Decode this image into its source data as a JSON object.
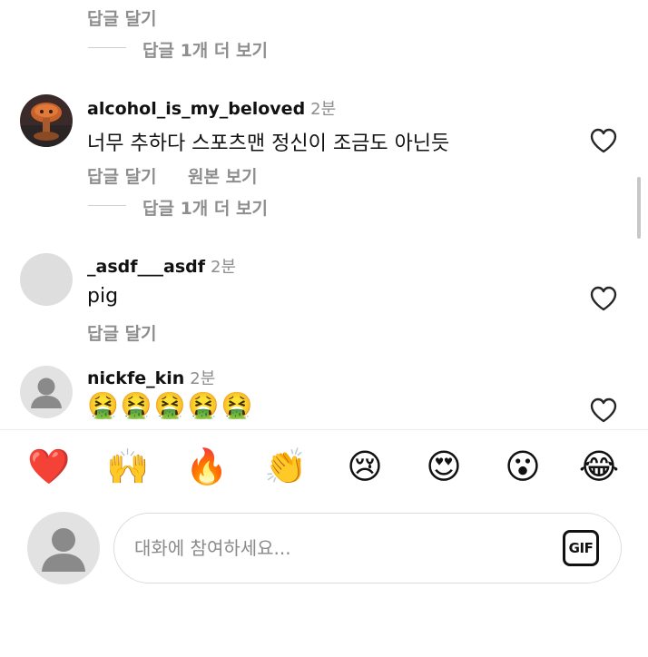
{
  "top_thread": {
    "reply_label": "답글 달기",
    "more_replies": "답글 1개 더 보기"
  },
  "comments": [
    {
      "username": "alcohol_is_my_beloved",
      "time": "2분",
      "text": "너무 추하다 스포츠맨 정신이 조금도 아닌듯",
      "reply_label": "답글 달기",
      "original_label": "원본 보기",
      "more_replies": "답글 1개 더 보기"
    },
    {
      "username": "_asdf___asdf",
      "time": "2분",
      "text": "pig",
      "reply_label": "답글 달기"
    },
    {
      "username": "nickfe_kin",
      "time": "2분",
      "text": "🤮🤮🤮🤮🤮"
    }
  ],
  "emoji_bar": [
    "❤️",
    "🙌",
    "🔥",
    "👏",
    "😢",
    "😍",
    "😮",
    "😂"
  ],
  "composer": {
    "placeholder": "대화에 참여하세요...",
    "gif_label": "GIF"
  }
}
